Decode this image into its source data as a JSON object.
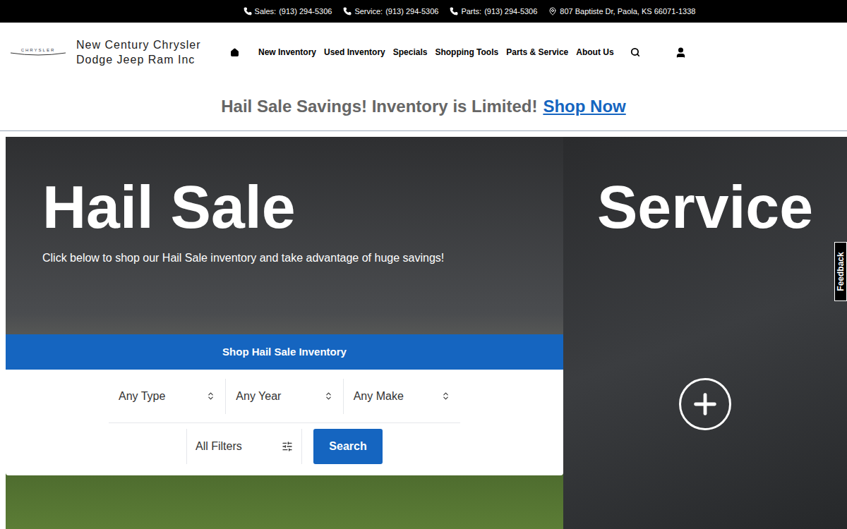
{
  "top_bar": {
    "contacts": [
      {
        "label": "Sales:",
        "value": "(913) 294-5306"
      },
      {
        "label": "Service:",
        "value": "(913) 294-5306"
      },
      {
        "label": "Parts:",
        "value": "(913) 294-5306"
      }
    ],
    "address": "807 Baptiste Dr, Paola, KS 66071-1338"
  },
  "header": {
    "logo": "CHRYSLER",
    "dealer_name": [
      "New Century Chrysler",
      "Dodge Jeep Ram Inc"
    ],
    "nav": [
      "New Inventory",
      "Used Inventory",
      "Specials",
      "Shopping Tools",
      "Parts & Service",
      "About Us"
    ]
  },
  "banner": {
    "text": "Hail Sale Savings! Inventory is Limited!",
    "link": "Shop Now"
  },
  "hero": {
    "title": "Hail Sale",
    "subtitle": "Click below to shop our Hail Sale inventory and take advantage of huge savings!",
    "shop_button": "Shop Hail Sale Inventory",
    "filters": [
      "Any Type",
      "Any Year",
      "Any Make"
    ],
    "all_filters": "All Filters",
    "search_button": "Search"
  },
  "service_panel": {
    "title": "Service"
  },
  "feedback": "Feedback"
}
